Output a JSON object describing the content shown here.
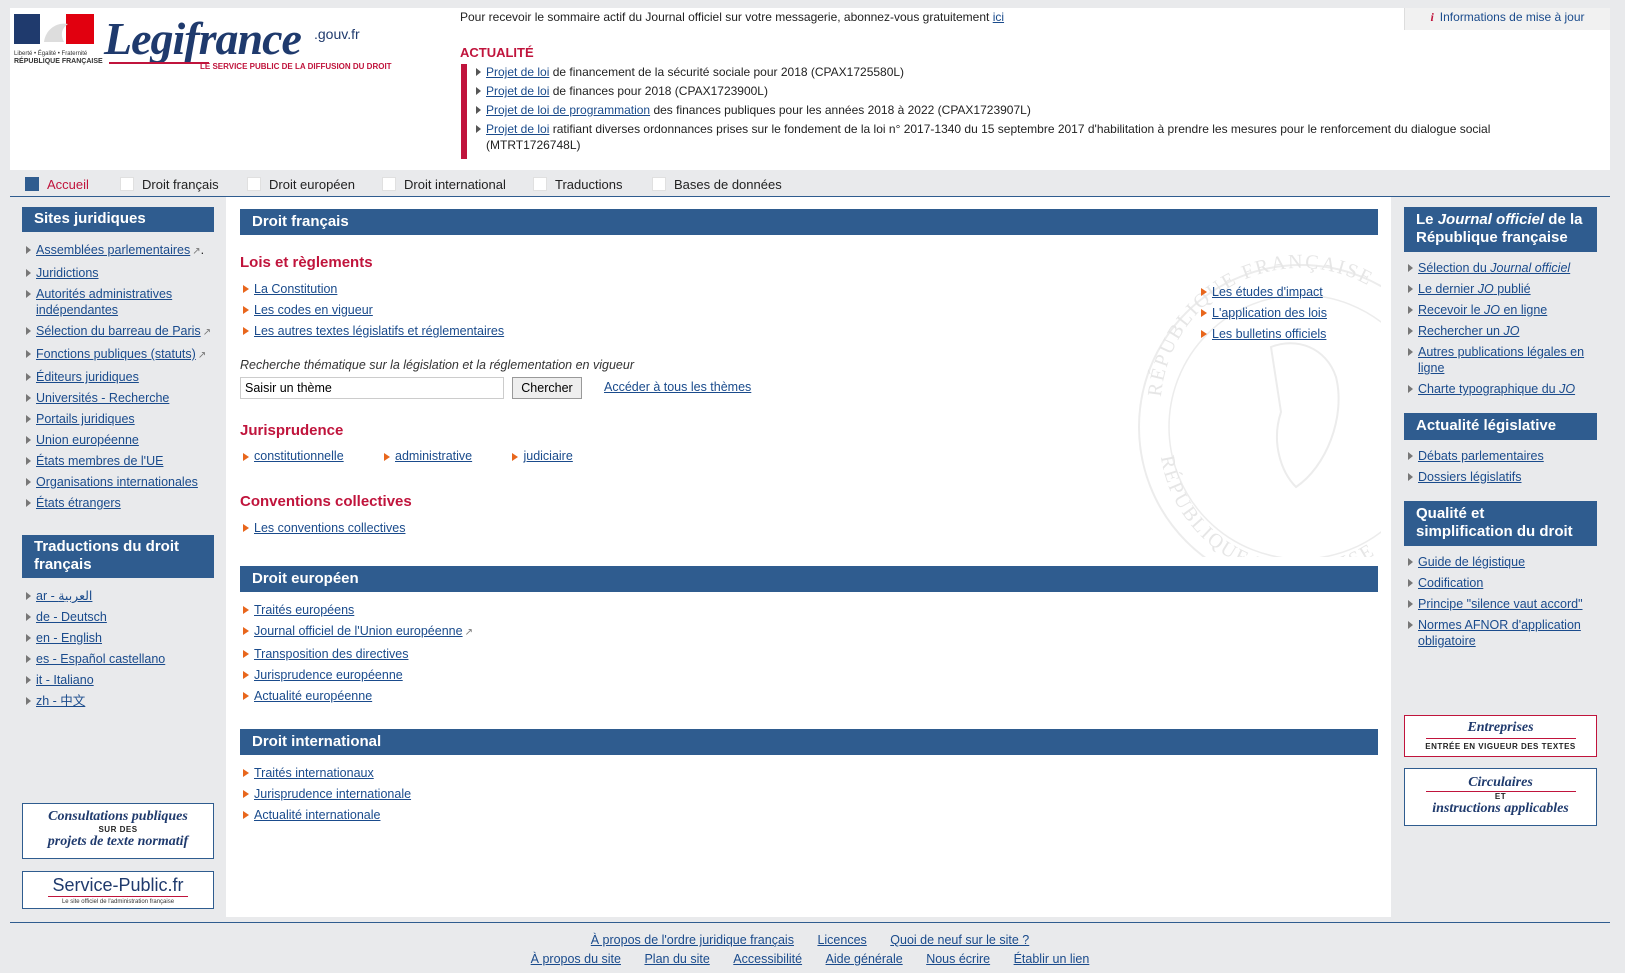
{
  "header": {
    "logo_text": "Legifrance",
    "logo_domain": ".gouv.fr",
    "logo_tagline": "LE SERVICE PUBLIC DE LA DIFFUSION DU DROIT",
    "rf_motto": "Liberté • Égalité • Fraternité",
    "rf_name": "RÉPUBLIQUE FRANÇAISE",
    "subscribe_text": "Pour recevoir le sommaire actif du Journal officiel sur votre messagerie, abonnez-vous gratuitement",
    "subscribe_link": "ici",
    "info_link": "Informations de mise à jour",
    "actualite_title": "ACTUALITÉ",
    "actualite": [
      {
        "link": "Projet de loi",
        "text": "de financement de la sécurité sociale pour 2018 (CPAX1725580L)"
      },
      {
        "link": "Projet de loi",
        "text": "de finances pour 2018 (CPAX1723900L)"
      },
      {
        "link": "Projet de loi de programmation",
        "text": "des finances publiques pour les années 2018 à 2022 (CPAX1723907L)"
      },
      {
        "link": "Projet de loi",
        "text": "ratifiant diverses ordonnances prises sur le fondement de la loi n° 2017-1340 du 15 septembre 2017 d'habilitation à prendre les mesures pour le renforcement du dialogue social (MTRT1726748L)"
      }
    ]
  },
  "nav": [
    "Accueil",
    "Droit français",
    "Droit européen",
    "Droit international",
    "Traductions",
    "Bases de données"
  ],
  "left": {
    "sites_title": "Sites juridiques",
    "sites": [
      "Assemblées parlementaires",
      "Juridictions",
      "Autorités administratives indépendantes",
      "Sélection du barreau de Paris",
      "Fonctions publiques (statuts)",
      "Éditeurs juridiques",
      "Universités - Recherche",
      "Portails juridiques",
      "Union européenne",
      "États membres de l'UE",
      "Organisations internationales",
      "États étrangers"
    ],
    "trad_title": "Traductions du droit français",
    "trads": [
      "ar - العربية",
      "de - Deutsch",
      "en - English",
      "es - Español castellano",
      "it - Italiano",
      "zh - 中文"
    ],
    "consult_line1": "Consultations publiques",
    "consult_line2": "SUR DES",
    "consult_line3": "projets de texte normatif",
    "sp_name": "Service-Public.fr",
    "sp_tag": "Le site officiel de l'administration française"
  },
  "center": {
    "df_title": "Droit français",
    "lois_title": "Lois et règlements",
    "lois": [
      "La Constitution",
      "Les codes en vigueur",
      "Les autres textes législatifs et réglementaires"
    ],
    "lois_right": [
      "Les études d'impact",
      "L'application des lois",
      "Les bulletins officiels"
    ],
    "search_label": "Recherche thématique sur la législation et la réglementation en vigueur",
    "search_value": "Saisir un thème",
    "search_button": "Chercher",
    "all_themes": "Accéder à tous les thèmes",
    "juris_title": "Jurisprudence",
    "juris": [
      "constitutionnelle",
      "administrative",
      "judiciaire"
    ],
    "conv_title": "Conventions collectives",
    "conv": [
      "Les conventions collectives"
    ],
    "de_title": "Droit européen",
    "de": [
      "Traités européens",
      "Journal officiel de l'Union européenne",
      "Transposition des directives",
      "Jurisprudence européenne",
      "Actualité européenne"
    ],
    "di_title": "Droit international",
    "di": [
      "Traités internationaux",
      "Jurisprudence internationale",
      "Actualité internationale"
    ],
    "seal_top": "RÉPUBLIQUE FRANÇAISE",
    "seal_bottom": "RÉPUBLIQUE FRANÇAISE"
  },
  "right": {
    "jo_title_1": "Le",
    "jo_title_2": "Journal officiel",
    "jo_title_3": "de la République française",
    "jo": [
      {
        "a": "Sélection du ",
        "b": "Journal officiel",
        "c": ""
      },
      {
        "a": "Le dernier ",
        "b": "JO",
        "c": " publié"
      },
      {
        "a": "Recevoir le ",
        "b": "JO",
        "c": " en ligne"
      },
      {
        "a": "Rechercher un ",
        "b": "JO",
        "c": ""
      },
      {
        "a": "Autres publications légales en ligne",
        "b": "",
        "c": ""
      },
      {
        "a": "Charte typographique du ",
        "b": "JO",
        "c": ""
      }
    ],
    "actu_title": "Actualité législative",
    "actu": [
      "Débats parlementaires",
      "Dossiers législatifs"
    ],
    "qual_title": "Qualité et simplification du droit",
    "qual": [
      "Guide de légistique",
      "Codification",
      "Principe \"silence vaut accord\"",
      "Normes AFNOR d'application obligatoire"
    ],
    "ent_title": "Entreprises",
    "ent_sub": "ENTRÉE EN VIGUEUR DES TEXTES",
    "circ_line1": "Circulaires",
    "circ_line2": "ET",
    "circ_line3": "instructions applicables"
  },
  "footer": {
    "row1": [
      "À propos de l'ordre juridique français",
      "Licences",
      "Quoi de neuf sur le site ?"
    ],
    "row2": [
      "À propos du site",
      "Plan du site",
      "Accessibilité",
      "Aide générale",
      "Nous écrire",
      "Établir un lien"
    ]
  },
  "colors": {
    "brand_blue": "#2f5c8f",
    "accent_red": "#c0143c",
    "bullet_orange": "#e8661c",
    "link": "#1a4b8c"
  }
}
